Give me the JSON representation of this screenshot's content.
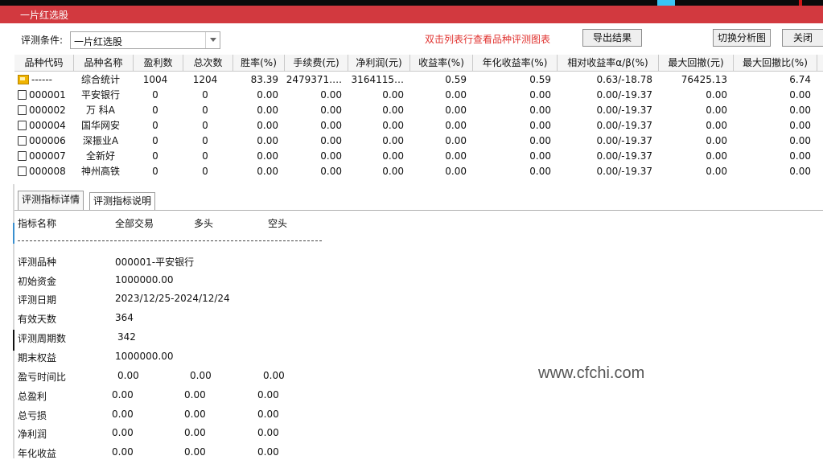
{
  "window": {
    "title": "一片红选股"
  },
  "toolbar": {
    "condition_label": "评测条件:",
    "condition_value": "一片红选股",
    "hint": "双击列表行查看品种评测图表",
    "export_label": "导出结果",
    "switch_label": "切换分析图",
    "close_label": "关闭"
  },
  "table": {
    "columns": [
      "品种代码",
      "品种名称",
      "盈利数",
      "总次数",
      "胜率(%)",
      "手续费(元)",
      "净利润(元)",
      "收益率(%)",
      "年化收益率(%)",
      "相对收益率α/β(%)",
      "最大回撤(元)",
      "最大回撤比(%)"
    ],
    "rows": [
      {
        "code": "------",
        "name": "综合统计",
        "win": "1004",
        "total": "1204",
        "rate": "83.39",
        "fee": "2479371….",
        "profit": "3164115…",
        "ret": "0.59",
        "annual": "0.59",
        "rel": "0.63/-18.78",
        "dd": "76425.13",
        "ddr": "6.74",
        "summary": true
      },
      {
        "code": "000001",
        "name": "平安银行",
        "win": "0",
        "total": "0",
        "rate": "0.00",
        "fee": "0.00",
        "profit": "0.00",
        "ret": "0.00",
        "annual": "0.00",
        "rel": "0.00/-19.37",
        "dd": "0.00",
        "ddr": "0.00"
      },
      {
        "code": "000002",
        "name": "万 科A",
        "win": "0",
        "total": "0",
        "rate": "0.00",
        "fee": "0.00",
        "profit": "0.00",
        "ret": "0.00",
        "annual": "0.00",
        "rel": "0.00/-19.37",
        "dd": "0.00",
        "ddr": "0.00"
      },
      {
        "code": "000004",
        "name": "国华网安",
        "win": "0",
        "total": "0",
        "rate": "0.00",
        "fee": "0.00",
        "profit": "0.00",
        "ret": "0.00",
        "annual": "0.00",
        "rel": "0.00/-19.37",
        "dd": "0.00",
        "ddr": "0.00"
      },
      {
        "code": "000006",
        "name": "深振业A",
        "win": "0",
        "total": "0",
        "rate": "0.00",
        "fee": "0.00",
        "profit": "0.00",
        "ret": "0.00",
        "annual": "0.00",
        "rel": "0.00/-19.37",
        "dd": "0.00",
        "ddr": "0.00"
      },
      {
        "code": "000007",
        "name": "全新好",
        "win": "0",
        "total": "0",
        "rate": "0.00",
        "fee": "0.00",
        "profit": "0.00",
        "ret": "0.00",
        "annual": "0.00",
        "rel": "0.00/-19.37",
        "dd": "0.00",
        "ddr": "0.00"
      },
      {
        "code": "000008",
        "name": "神州高铁",
        "win": "0",
        "total": "0",
        "rate": "0.00",
        "fee": "0.00",
        "profit": "0.00",
        "ret": "0.00",
        "annual": "0.00",
        "rel": "0.00/-19.37",
        "dd": "0.00",
        "ddr": "0.00"
      }
    ]
  },
  "tabs": [
    "评测指标详情",
    "评测指标说明"
  ],
  "detail": {
    "headers": [
      "指标名称",
      "全部交易",
      "多头",
      "空头"
    ],
    "info": [
      {
        "label": "评测品种",
        "value": "000001-平安银行"
      },
      {
        "label": "初始资金",
        "value": "1000000.00"
      },
      {
        "label": "评测日期",
        "value": "2023/12/25-2024/12/24"
      },
      {
        "label": "有效天数",
        "value": "364"
      },
      {
        "label": "评测周期数",
        "value": "342"
      },
      {
        "label": "期末权益",
        "value": "1000000.00"
      }
    ],
    "metrics": [
      {
        "label": "盈亏时间比",
        "all": "0.00",
        "long": "0.00",
        "short": "0.00"
      },
      {
        "label": "总盈利",
        "all": "0.00",
        "long": "0.00",
        "short": "0.00"
      },
      {
        "label": "总亏损",
        "all": "0.00",
        "long": "0.00",
        "short": "0.00"
      },
      {
        "label": "净利润",
        "all": "0.00",
        "long": "0.00",
        "short": "0.00"
      },
      {
        "label": "年化收益",
        "all": "0.00",
        "long": "0.00",
        "short": "0.00"
      }
    ]
  },
  "watermark": "www.cfchi.com",
  "colors": {
    "titlebar": "#d2393f",
    "hint": "#e0312e"
  }
}
